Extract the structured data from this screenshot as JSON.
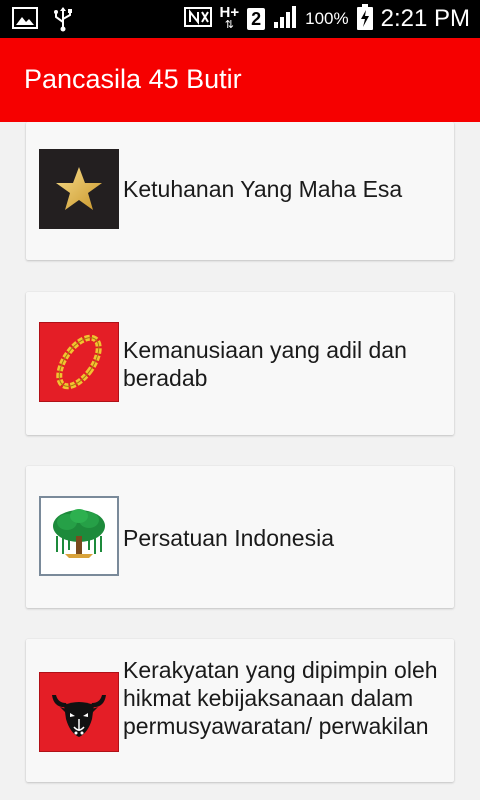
{
  "status_bar": {
    "icons_left": [
      "image-icon",
      "usb-icon"
    ],
    "network_type": "H+",
    "sim_slot": "2",
    "battery_percent": "100%",
    "time": "2:21 PM"
  },
  "app_bar": {
    "title": "Pancasila 45 Butir"
  },
  "principles": [
    {
      "label": "Ketuhanan Yang Maha Esa",
      "emblem": "star-icon",
      "emblem_bg": "#231f20"
    },
    {
      "label": "Kemanusiaan yang adil dan beradab",
      "emblem": "chain-icon",
      "emblem_bg": "#e41e26"
    },
    {
      "label": "Persatuan Indonesia",
      "emblem": "banyan-tree-icon",
      "emblem_bg": "#ffffff"
    },
    {
      "label": "Kerakyatan yang dipimpin oleh hikmat kebijaksanaan dalam permusyawaratan/ perwakilan",
      "emblem": "bull-head-icon",
      "emblem_bg": "#e41e26"
    }
  ],
  "colors": {
    "app_bar": "#f60000",
    "status_bar": "#000000",
    "background": "#f2f2f2"
  }
}
